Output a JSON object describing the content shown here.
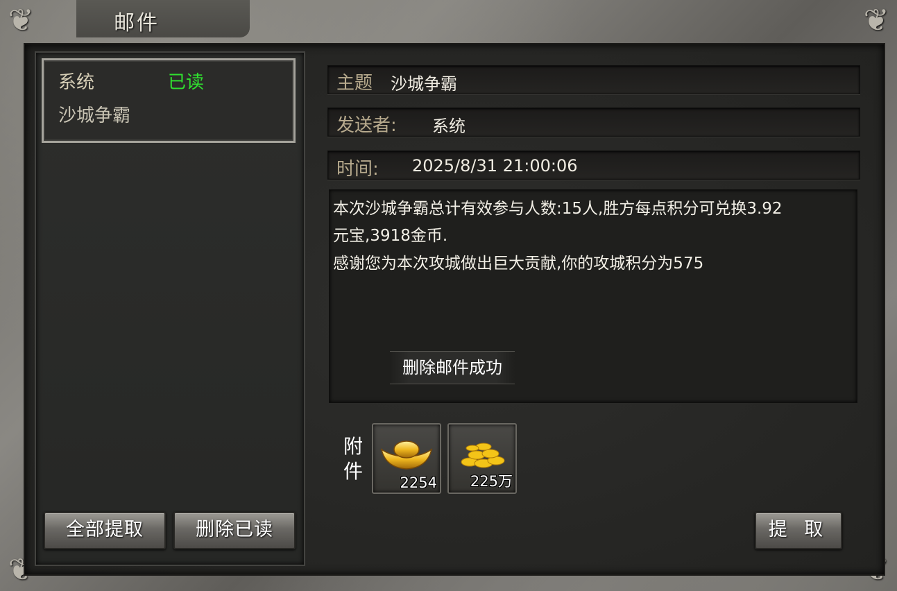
{
  "window": {
    "title": "邮件"
  },
  "mail_list": {
    "items": [
      {
        "sender": "系统",
        "status": "已读",
        "subject": "沙城争霸"
      }
    ],
    "collect_all_label": "全部提取",
    "delete_read_label": "删除已读"
  },
  "detail": {
    "subject_label": "主题",
    "subject_value": "沙城争霸",
    "sender_label": "发送者:",
    "sender_value": "系统",
    "time_label": "时间:",
    "time_value": "2025/8/31 21:00:06",
    "body_lines": [
      "本次沙城争霸总计有效参与人数:15人,胜方每点积分可兑换3.92",
      "元宝,3918金币.",
      "感谢您为本次攻城做出巨大贡献,你的攻城积分为575"
    ],
    "toast": "删除邮件成功",
    "attachments_label_top": "附",
    "attachments_label_bottom": "件",
    "attachments": [
      {
        "icon": "gold-ingot-icon",
        "count": "2254"
      },
      {
        "icon": "gold-coins-icon",
        "count": "225万"
      }
    ],
    "collect_label": "提 取"
  },
  "colors": {
    "read_status": "#30e030",
    "label": "#b8ab8e",
    "text": "#f0ece2"
  }
}
